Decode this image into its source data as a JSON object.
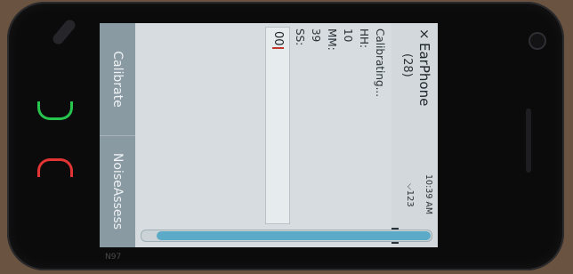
{
  "app": {
    "title": "EarPhone",
    "close_symbol": "×",
    "subtitle": "(28)"
  },
  "status": {
    "time": "10:39 AM",
    "network": "123"
  },
  "content": {
    "line1": "Calibrating...",
    "hh_label": "HH:",
    "hh_value": "10",
    "mm_label": "MM:",
    "mm_value": "39",
    "ss_label": "SS:",
    "ss_value": "00"
  },
  "progress": {
    "value": 0.95,
    "color": "#5aaac8"
  },
  "softkeys": {
    "left": "Calibrate",
    "right": "NoiseAssess"
  },
  "device": {
    "model": "N97"
  }
}
